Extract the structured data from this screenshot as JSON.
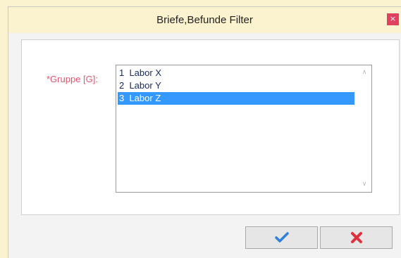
{
  "window": {
    "title": "Briefe,Befunde Filter",
    "close_glyph": "×"
  },
  "form": {
    "group_label": "*Gruppe [G]:",
    "list_items": [
      {
        "label": "1  Labor X",
        "selected": false
      },
      {
        "label": "2  Labor Y",
        "selected": false
      },
      {
        "label": "3  Labor Z",
        "selected": true
      }
    ],
    "scroll_up_glyph": "∧",
    "scroll_down_glyph": "∨"
  },
  "buttons": {
    "ok_icon": "checkmark-icon",
    "cancel_icon": "x-icon"
  },
  "colors": {
    "accent_selection": "#3399ff",
    "required_label": "#e0556b",
    "ok_icon": "#2f7fd8",
    "cancel_icon": "#e0303d",
    "close_button": "#e0415e"
  }
}
